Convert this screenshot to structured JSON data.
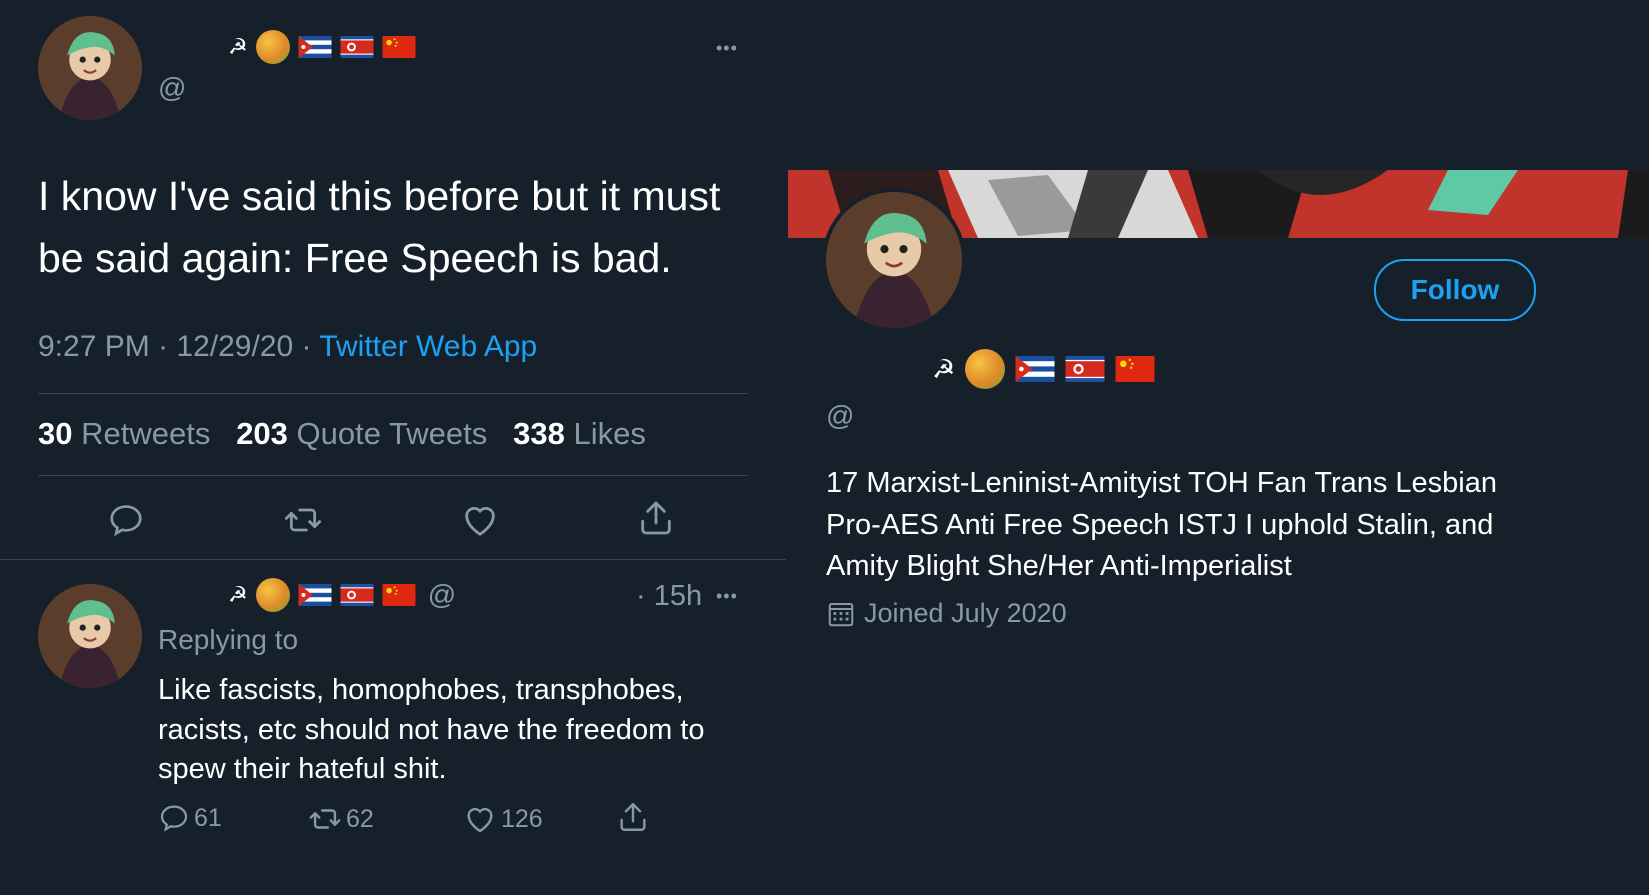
{
  "main_tweet": {
    "handle": "@",
    "name_emojis": [
      "hammer-sickle",
      "mango",
      "flag-cuba",
      "flag-north-korea",
      "flag-china"
    ],
    "text_line1": "I know I've said this before but it must",
    "text_line2": "be said again: Free Speech is bad.",
    "time": "9:27 PM",
    "date": "12/29/20",
    "source": "Twitter Web App",
    "separator": "·",
    "retweets_count": "30",
    "retweets_label": "Retweets",
    "quotes_count": "203",
    "quotes_label": "Quote Tweets",
    "likes_count": "338",
    "likes_label": "Likes",
    "more_label": "•••"
  },
  "reply_tweet": {
    "handle": "@",
    "time": "· 15h",
    "more_label": "•••",
    "replying_to": "Replying to",
    "text_line1": "Like fascists, homophobes, transphobes,",
    "text_line2": "racists, etc should not have the freedom to",
    "text_line3": "spew their hateful shit.",
    "replies": "61",
    "retweets": "62",
    "likes": "126"
  },
  "profile": {
    "follow_label": "Follow",
    "handle": "@",
    "bio_line1": "17 Marxist-Leninist-Amityist TOH Fan Trans Lesbian",
    "bio_line2": "Pro-AES Anti Free Speech ISTJ I uphold Stalin, and",
    "bio_line3": "Amity Blight She/Her Anti-Imperialist",
    "joined": "Joined July 2020"
  },
  "colors": {
    "background": "#15202b",
    "accent": "#1da1f2",
    "muted": "#8899a6",
    "divider": "#38444d",
    "banner_red": "#c0342c"
  },
  "icons": [
    "reply-icon",
    "retweet-icon",
    "like-icon",
    "share-icon",
    "calendar-icon",
    "more-icon"
  ]
}
